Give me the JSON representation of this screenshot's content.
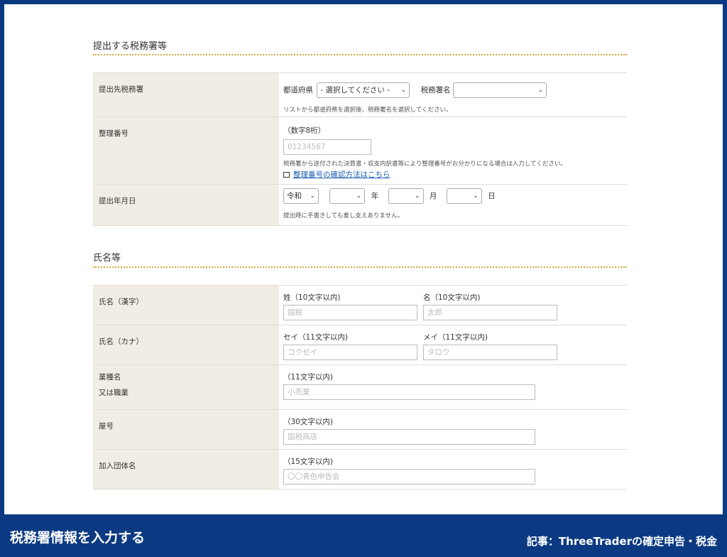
{
  "sections": {
    "tax_office": {
      "title": "提出する税務署等"
    },
    "name": {
      "title": "氏名等"
    }
  },
  "tax_office_row": {
    "label": "提出先税務署",
    "prefecture_label": "都道府県",
    "prefecture_value": "- 選択してください -",
    "office_label": "税務署名",
    "office_value": "",
    "help": "リストから都道府県を選択後、税務署名を選択してください。"
  },
  "ref_row": {
    "label": "整理番号",
    "hint": "（数字8桁）",
    "placeholder": "01234567",
    "help": "税務署から送付された決算書・収支内訳書等により整理番号がお分かりになる場合は入力してください。",
    "link": "整理番号の確認方法はこちら"
  },
  "date_row": {
    "label": "提出年月日",
    "era_value": "令和",
    "year_label": "年",
    "month_label": "月",
    "day_label": "日",
    "help": "提出時に手書きしても差し支えありません。"
  },
  "name_kanji_row": {
    "label": "氏名（漢字）",
    "last_label": "姓（10文字以内)",
    "last_placeholder": "国税",
    "first_label": "名（10文字以内)",
    "first_placeholder": "太郎"
  },
  "name_kana_row": {
    "label": "氏名（カナ）",
    "last_label": "セイ（11文字以内)",
    "last_placeholder": "コクゼイ",
    "first_label": "メイ（11文字以内)",
    "first_placeholder": "タロウ"
  },
  "job_row": {
    "label_line1": "業種名",
    "label_line2": "又は職業",
    "hint": "（11文字以内)",
    "placeholder": "小売業"
  },
  "shop_row": {
    "label": "屋号",
    "hint": "（30文字以内)",
    "placeholder": "国税商店"
  },
  "group_row": {
    "label": "加入団体名",
    "hint": "（15文字以内)",
    "placeholder": "〇〇青色申告会"
  },
  "footer": {
    "caption": "税務署情報を入力する",
    "credit": "記事：ThreeTraderの確定申告・税金"
  },
  "colors": {
    "frame_blue": "#0b3a82",
    "label_bg": "#f1ede4",
    "dotted_line": "#d4a63a",
    "link": "#1a5fb4"
  }
}
